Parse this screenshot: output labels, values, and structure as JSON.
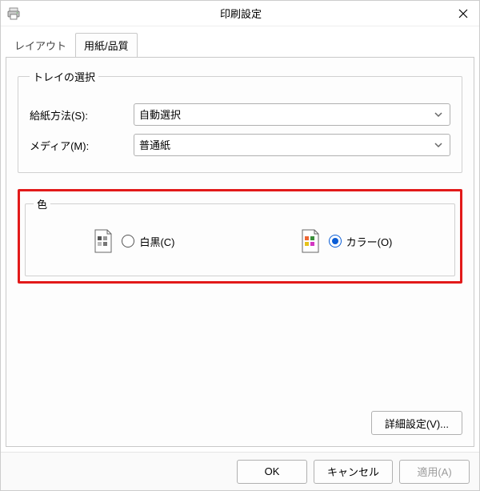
{
  "titlebar": {
    "title": "印刷設定"
  },
  "tabs": {
    "layout": "レイアウト",
    "paper": "用紙/品質"
  },
  "tray": {
    "legend": "トレイの選択",
    "source_label": "給紙方法(S):",
    "source_value": "自動選択",
    "media_label": "メディア(M):",
    "media_value": "普通紙"
  },
  "color": {
    "legend": "色",
    "bw_label": "白黒(C)",
    "color_label": "カラー(O)",
    "selected": "color"
  },
  "buttons": {
    "advanced": "詳細設定(V)...",
    "ok": "OK",
    "cancel": "キャンセル",
    "apply": "適用(A)"
  }
}
